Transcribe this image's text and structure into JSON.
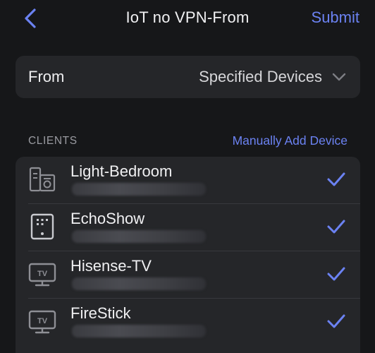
{
  "header": {
    "title": "IoT no VPN-From",
    "submit_label": "Submit",
    "back_icon": "chevron-left-icon"
  },
  "from": {
    "label": "From",
    "value": "Specified Devices",
    "chevron_icon": "chevron-down-icon"
  },
  "clients": {
    "section_label": "CLIENTS",
    "manual_add_label": "Manually Add Device",
    "items": [
      {
        "name": "Light-Bedroom",
        "icon": "smart-plug-icon",
        "checked": true
      },
      {
        "name": "EchoShow",
        "icon": "smart-display-icon",
        "checked": true
      },
      {
        "name": "Hisense-TV",
        "icon": "tv-icon",
        "checked": true
      },
      {
        "name": "FireStick",
        "icon": "tv-icon",
        "checked": true
      }
    ]
  },
  "colors": {
    "accent": "#6b82f2",
    "background": "#161719",
    "card": "#252629"
  }
}
